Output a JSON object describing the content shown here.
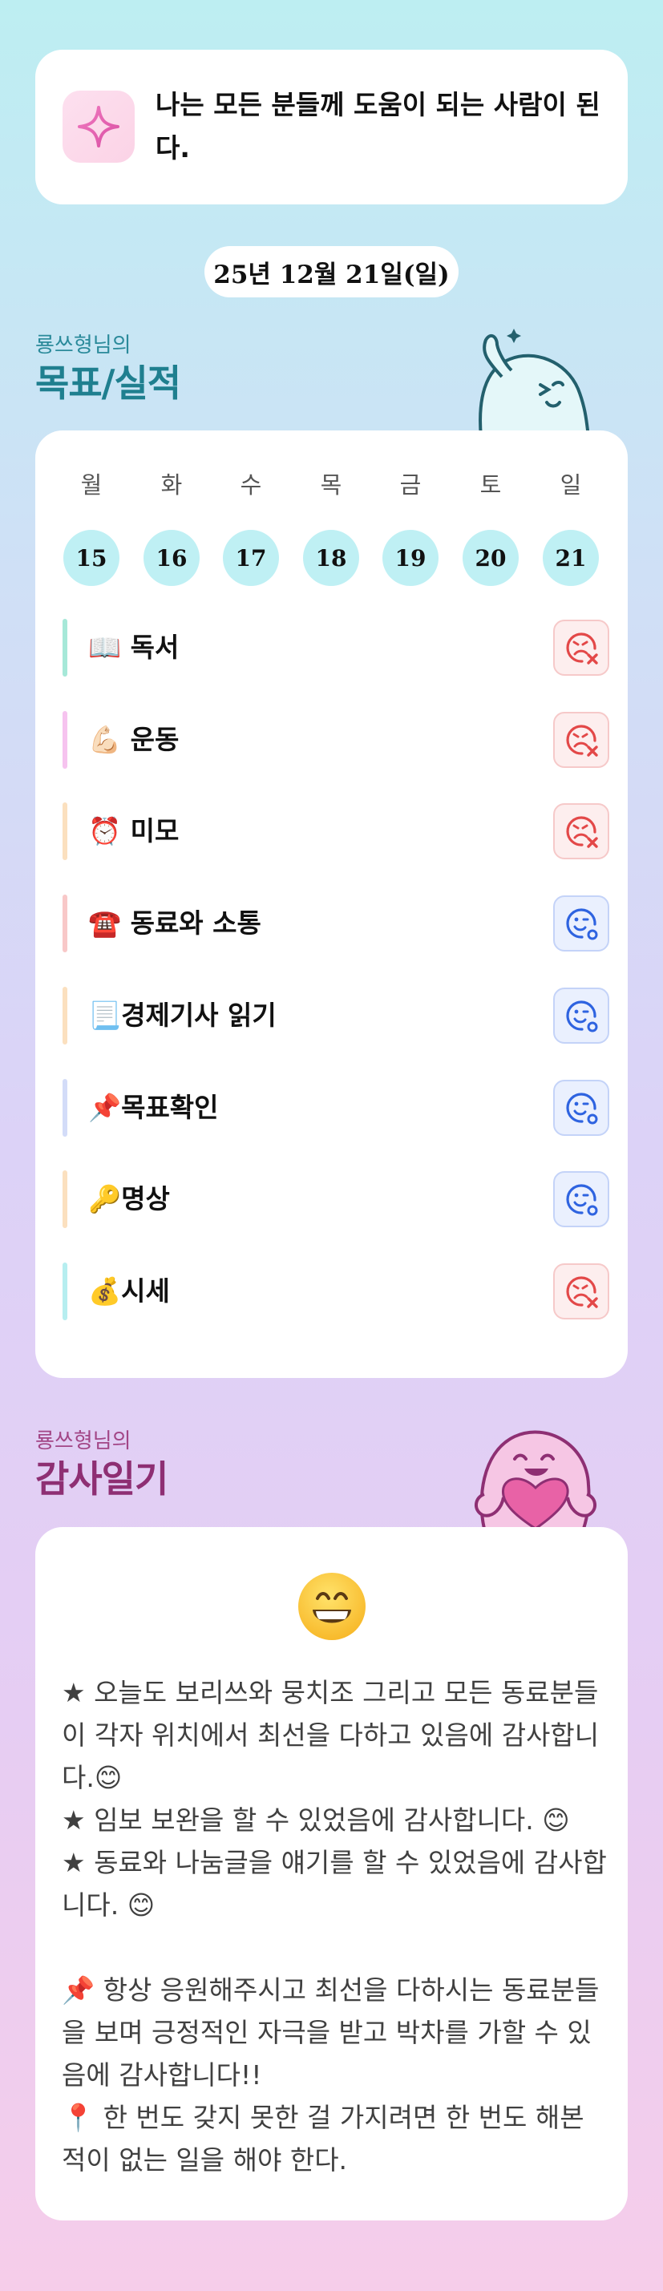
{
  "motto": {
    "icon": "sparkle-icon",
    "text": "나는 모든 분들께 도움이 되는 사람이 된다."
  },
  "date_label": "25년 12월 21일(일)",
  "goals_section": {
    "owner": "룡쓰형님의",
    "title": "목표/실적",
    "mascot": "waving-ghost-mascot"
  },
  "week": {
    "days": [
      {
        "label": "월",
        "date": "15"
      },
      {
        "label": "화",
        "date": "16"
      },
      {
        "label": "수",
        "date": "17"
      },
      {
        "label": "목",
        "date": "18"
      },
      {
        "label": "금",
        "date": "19"
      },
      {
        "label": "토",
        "date": "20"
      },
      {
        "label": "일",
        "date": "21"
      }
    ]
  },
  "goals": [
    {
      "label": "📖 독서",
      "status": "fail",
      "bar_color": "#a6e8d8"
    },
    {
      "label": "💪🏻 운동",
      "status": "fail",
      "bar_color": "#f6c3ef"
    },
    {
      "label": "⏰ 미모",
      "status": "fail",
      "bar_color": "#fbe0bf"
    },
    {
      "label": "☎️ 동료와 소통",
      "status": "ok",
      "bar_color": "#f8c8c8"
    },
    {
      "label": "📃경제기사 읽기",
      "status": "ok",
      "bar_color": "#fbe0bf"
    },
    {
      "label": "📌목표확인",
      "status": "ok",
      "bar_color": "#d3dcf8"
    },
    {
      "label": "🔑명상",
      "status": "ok",
      "bar_color": "#fbe0bf"
    },
    {
      "label": "💰시세",
      "status": "fail",
      "bar_color": "#b6eef0"
    }
  ],
  "status_colors": {
    "fail": "#e34848",
    "ok": "#2e63e0"
  },
  "thanks_section": {
    "owner": "룡쓰형님의",
    "title": "감사일기",
    "mascot": "heart-hugging-mascot",
    "emoji": "grinning-face-icon",
    "body": "★ 오늘도 보리쓰와 뭉치조 그리고 모든 동료분들이 각자 위치에서 최선을 다하고 있음에 감사합니다.😊\n★ 임보 보완을 할 수 있었음에 감사합니다. 😊\n★ 동료와 나눔글을 얘기를 할 수 있었음에 감사합니다. 😊\n\n📌 항상 응원해주시고 최선을 다하시는 동료분들을 보며 긍정적인 자극을 받고 박차를 가할 수 있음에 감사합니다!!\n📍 한 번도 갖지 못한 걸 가지려면 한 번도 해본 적이 없는 일을 해야 한다."
  }
}
